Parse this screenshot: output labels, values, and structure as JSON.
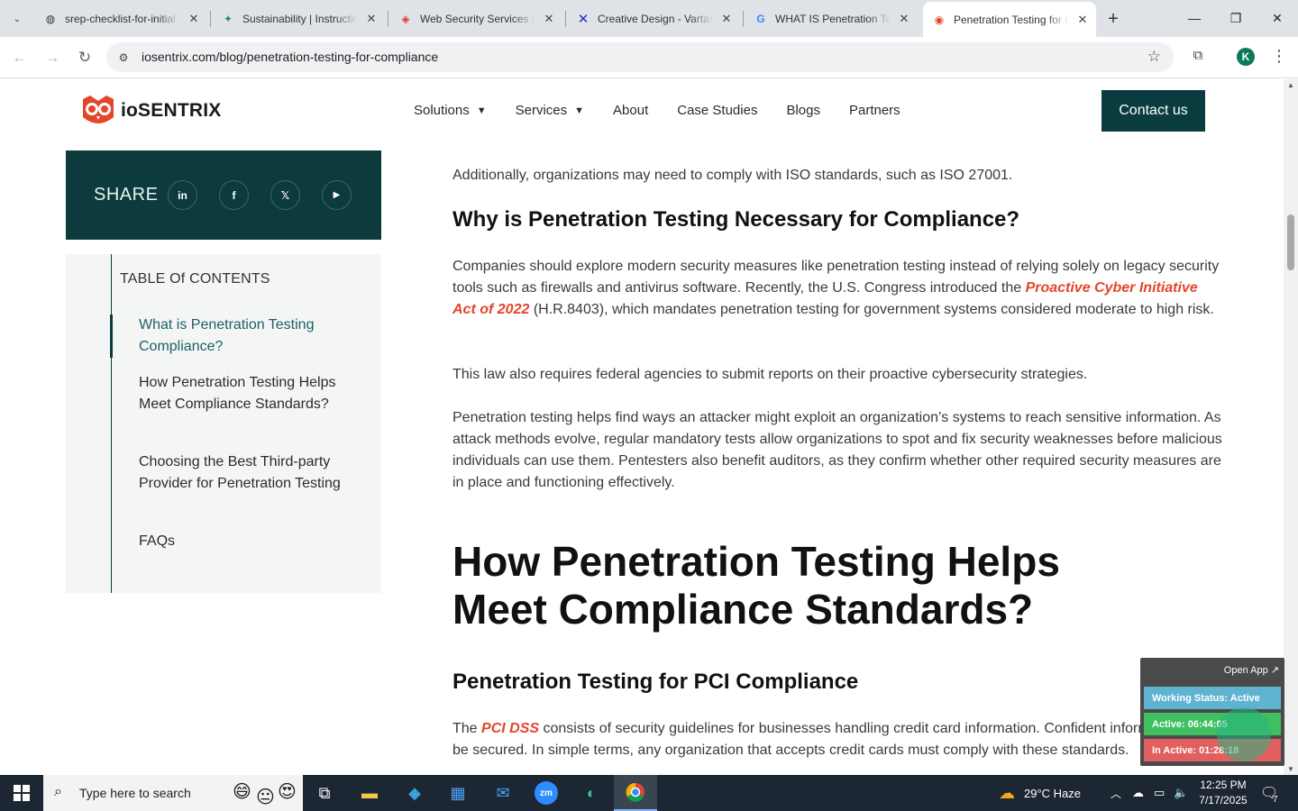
{
  "browser": {
    "tabs": [
      {
        "title": "srep-checklist-for-initial",
        "icon": "globe-icon"
      },
      {
        "title": "Sustainability | Instructio",
        "icon": "sparkle-icon"
      },
      {
        "title": "Web Security Services | ",
        "icon": "shield-icon"
      },
      {
        "title": "Creative Design - Vartan",
        "icon": "x-logo-icon"
      },
      {
        "title": "WHAT IS Penetration Te",
        "icon": "google-icon"
      },
      {
        "title": "Penetration Testing for C",
        "icon": "owl-icon"
      }
    ],
    "url": "iosentrix.com/blog/penetration-testing-for-compliance",
    "profile_initial": "K"
  },
  "site": {
    "logo_text": "ioSENTRIX",
    "nav": [
      {
        "label": "Solutions",
        "dropdown": true
      },
      {
        "label": "Services",
        "dropdown": true
      },
      {
        "label": "About",
        "dropdown": false
      },
      {
        "label": "Case Studies",
        "dropdown": false
      },
      {
        "label": "Blogs",
        "dropdown": false
      },
      {
        "label": "Partners",
        "dropdown": false
      }
    ],
    "contact_label": "Contact us"
  },
  "share": {
    "label": "SHARE",
    "icons": [
      "linkedin-icon",
      "facebook-icon",
      "x-icon",
      "youtube-icon"
    ],
    "glyphs": [
      "in",
      "f",
      "𝕏",
      "▶"
    ]
  },
  "toc": {
    "title": "TABLE Of CONTENTS",
    "items": [
      "What is Penetration Testing Compliance?",
      "How Penetration Testing Helps Meet Compliance Standards?",
      "Choosing the Best Third-party Provider for Penetration Testing",
      "FAQs"
    ]
  },
  "article": {
    "p0": "Additionally, organizations may need to comply with ISO standards, such as ISO 27001.",
    "h_necessary": "Why is Penetration Testing Necessary for Compliance?",
    "p1_a": "Companies should explore modern security measures like penetration testing instead of relying solely on legacy security tools such as firewalls and antivirus software. Recently, the U.S. Congress introduced the ",
    "p1_link": "Proactive Cyber Initiative Act of 2022",
    "p1_b": " (H.R.8403), which mandates penetration testing for government systems considered moderate to high risk.",
    "p2": "This law also requires federal agencies to submit reports on their proactive cybersecurity strategies.",
    "p3": "Penetration testing helps find ways an attacker might exploit an organization’s systems to reach sensitive information. As attack methods evolve, regular mandatory tests allow organizations to spot and fix security weaknesses before malicious individuals can use them. Pentesters also benefit auditors, as they confirm whether other required security measures are in place and functioning effectively.",
    "h_how": "How Penetration Testing Helps Meet Compliance Standards?",
    "h_pci": "Penetration Testing for PCI Compliance",
    "p4_a": "The ",
    "p4_link": "PCI DSS",
    "p4_b": " consists of security guidelines for businesses handling credit card information. Confident information must be secured. In simple terms, any organization that accepts credit cards must comply with these standards."
  },
  "widget": {
    "open_app": "Open App ↗",
    "status": "Working Status: Active",
    "active": "Active: 06:44:05",
    "inactive": "In Active: 01:28:18"
  },
  "taskbar": {
    "search_placeholder": "Type here to search",
    "weather": "29°C  Haze",
    "time": "12:25 PM",
    "date": "7/17/2025",
    "notification_count": "7"
  },
  "colors": {
    "brand_dark": "#0d3b3d",
    "accent": "#e4462b"
  }
}
